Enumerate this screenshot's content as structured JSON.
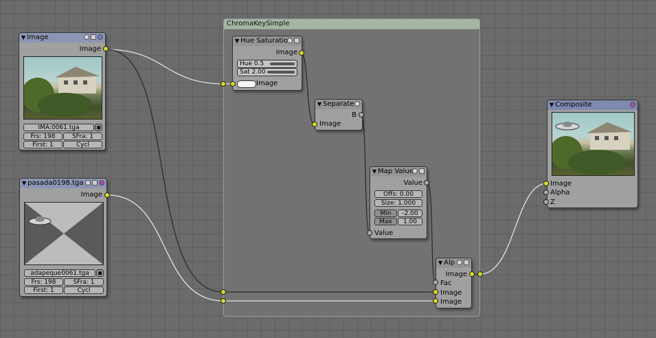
{
  "group": {
    "title": "ChromaKeySimple"
  },
  "image_node": {
    "title": "Image",
    "output": "Image",
    "file": "IMA:0061.tga",
    "frs": "Frs: 198",
    "sfra": "SFra: 1",
    "first": "First: 1",
    "cycl": "Cycl"
  },
  "pasada_node": {
    "title": "pasada0198.tga",
    "output": "Image",
    "file": "adapeque0061.tga",
    "frs": "Frs: 198",
    "sfra": "SFra: 1",
    "first": "First: 1",
    "cycl": "Cycl"
  },
  "hue_node": {
    "title": "Hue Saturatio",
    "output": "Image",
    "hue": "Hue 0.5",
    "sat": "Sat 2.00",
    "input": "Image"
  },
  "separate_node": {
    "title": "Separate",
    "output": "B",
    "input": "Image"
  },
  "mapvalue_node": {
    "title": "Map Value",
    "output": "Value",
    "offs": "Offs: 0.00",
    "size": "Size: 1.000",
    "min_label": "Min",
    "min_value": "-2.00",
    "max_label": "Max",
    "max_value": "1.00",
    "input": "Value"
  },
  "alp_node": {
    "title": "Alp",
    "output": "Image",
    "inputs": [
      "Fac",
      "Image",
      "Image"
    ]
  },
  "composite_node": {
    "title": "Composite",
    "inputs": [
      "Image",
      "Alpha",
      "Z"
    ]
  },
  "colors": {
    "socket_yellow": "#d8d82a",
    "socket_gray": "#a8a8a8",
    "header_blue": "#8c95b4",
    "group_header": "#a4b6a4"
  }
}
